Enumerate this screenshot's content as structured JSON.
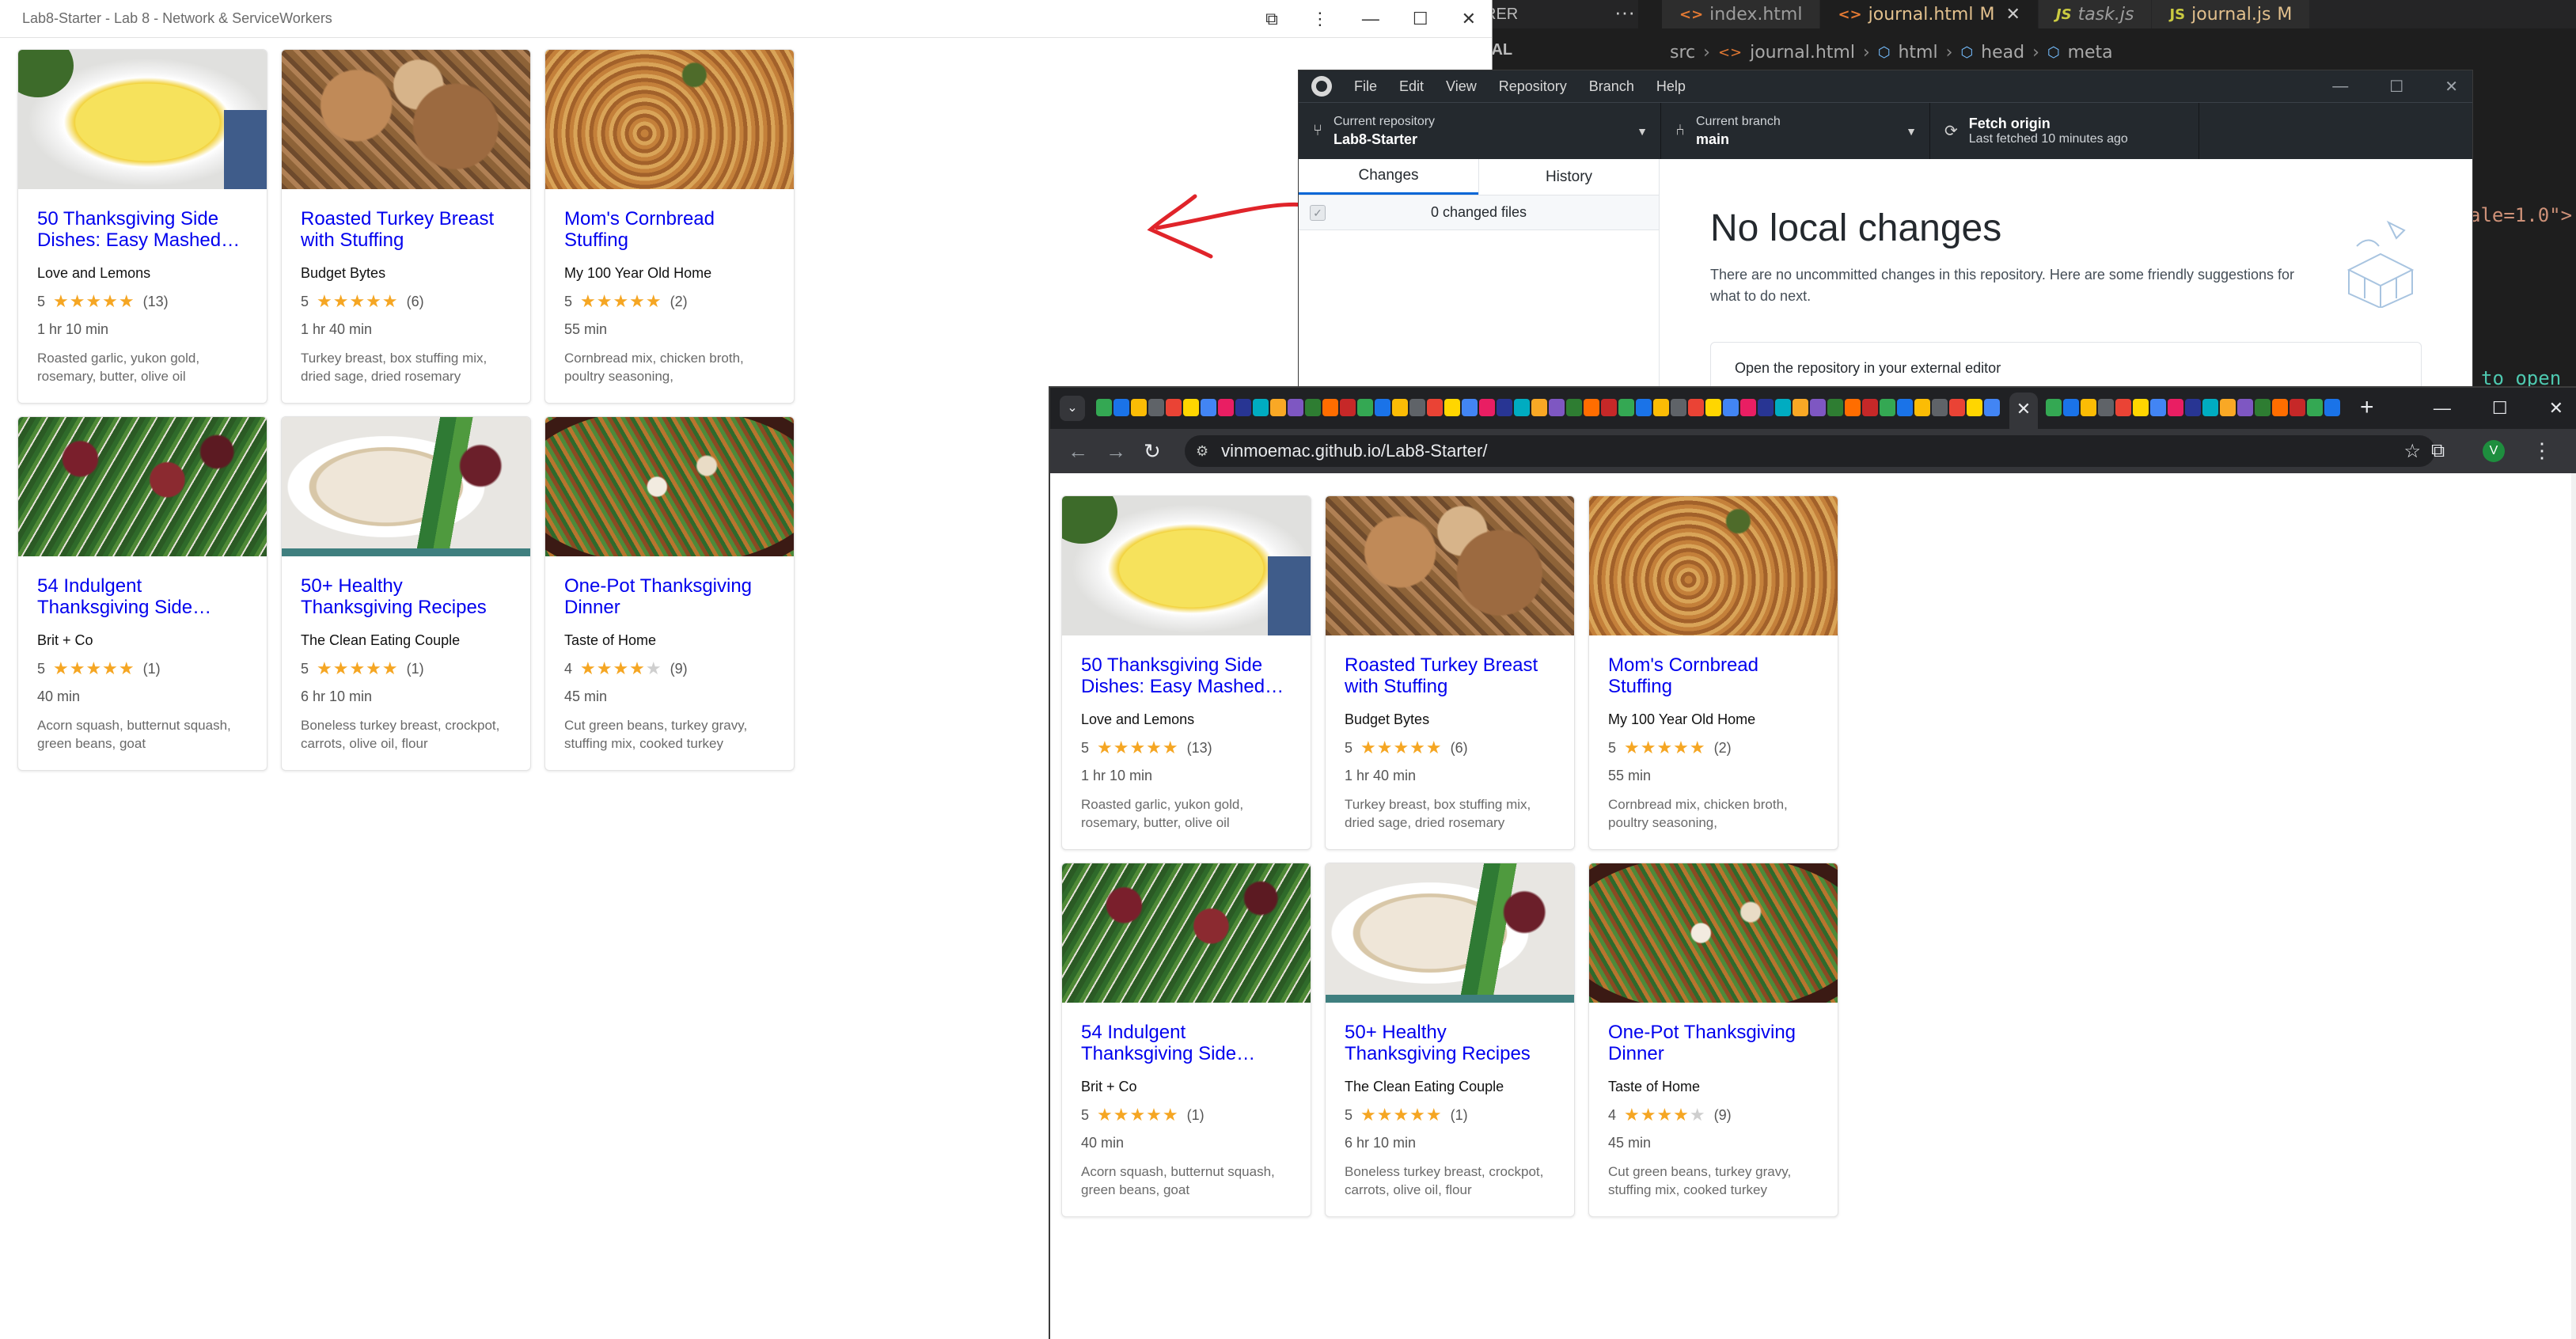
{
  "vscode": {
    "explorer_fragment": "RER",
    "side_fragment": "NAL",
    "tabs": [
      {
        "icon": "<>",
        "label": "index.html",
        "mod": "",
        "active": false
      },
      {
        "icon": "<>",
        "label": "journal.html",
        "mod": "M",
        "active": true
      },
      {
        "icon": "JS",
        "label": "task.js",
        "mod": "",
        "active": false
      },
      {
        "icon": "JS",
        "label": "journal.js",
        "mod": "M",
        "active": false
      }
    ],
    "breadcrumb": [
      "src",
      "journal.html",
      "html",
      "head",
      "meta"
    ],
    "code_frag_1": "ale=1.0\">",
    "code_frag_2": "to open t"
  },
  "popup": {
    "title": "Lab8-Starter - Lab 8 - Network & ServiceWorkers"
  },
  "recipes": [
    {
      "title": "50 Thanksgiving Side Dishes: Easy Mashed…",
      "org": "Love and Lemons",
      "rating": "5",
      "stars": 5,
      "reviews": "(13)",
      "time": "1 hr 10 min",
      "ingredients": "Roasted garlic, yukon gold, rosemary, butter, olive oil",
      "image": "img-mashed"
    },
    {
      "title": "Roasted Turkey Breast with Stuffing",
      "org": "Budget Bytes",
      "rating": "5",
      "stars": 5,
      "reviews": "(6)",
      "time": "1 hr 40 min",
      "ingredients": "Turkey breast, box stuffing mix, dried sage, dried rosemary",
      "image": "img-turkey"
    },
    {
      "title": "Mom's Cornbread Stuffing",
      "org": "My 100 Year Old Home",
      "rating": "5",
      "stars": 5,
      "reviews": "(2)",
      "time": "55 min",
      "ingredients": "Cornbread mix, chicken broth, poultry seasoning,",
      "image": "img-stuffing"
    },
    {
      "title": "54 Indulgent Thanksgiving Side…",
      "org": "Brit + Co",
      "rating": "5",
      "stars": 5,
      "reviews": "(1)",
      "time": "40 min",
      "ingredients": "Acorn squash, butternut squash, green beans, goat",
      "image": "img-greens"
    },
    {
      "title": "50+ Healthy Thanksgiving Recipes",
      "org": "The Clean Eating Couple",
      "rating": "5",
      "stars": 5,
      "reviews": "(1)",
      "time": "6 hr 10 min",
      "ingredients": "Boneless turkey breast, crockpot, carrots, olive oil, flour",
      "image": "img-healthy"
    },
    {
      "title": "One-Pot Thanksgiving Dinner",
      "org": "Taste of Home",
      "rating": "4",
      "stars": 4,
      "reviews": "(9)",
      "time": "45 min",
      "ingredients": "Cut green beans, turkey gravy, stuffing mix, cooked turkey",
      "image": "img-onepot"
    }
  ],
  "github": {
    "menu": [
      "File",
      "Edit",
      "View",
      "Repository",
      "Branch",
      "Help"
    ],
    "repo_label": "Current repository",
    "repo_value": "Lab8-Starter",
    "branch_label": "Current branch",
    "branch_value": "main",
    "fetch_label": "Fetch origin",
    "fetch_sub": "Last fetched 10 minutes ago",
    "tab_changes": "Changes",
    "tab_history": "History",
    "changed_files": "0 changed files",
    "heading": "No local changes",
    "subtext": "There are no uncommitted changes in this repository. Here are some friendly suggestions for what to do next.",
    "suggestion": "Open the repository in your external editor"
  },
  "chrome": {
    "url": "vinmoemac.github.io/Lab8-Starter/",
    "avatar_letter": "V"
  },
  "colors": {
    "link": "#0000ee",
    "star": "#f5a623",
    "annotation_arrow": "#e0242a"
  }
}
